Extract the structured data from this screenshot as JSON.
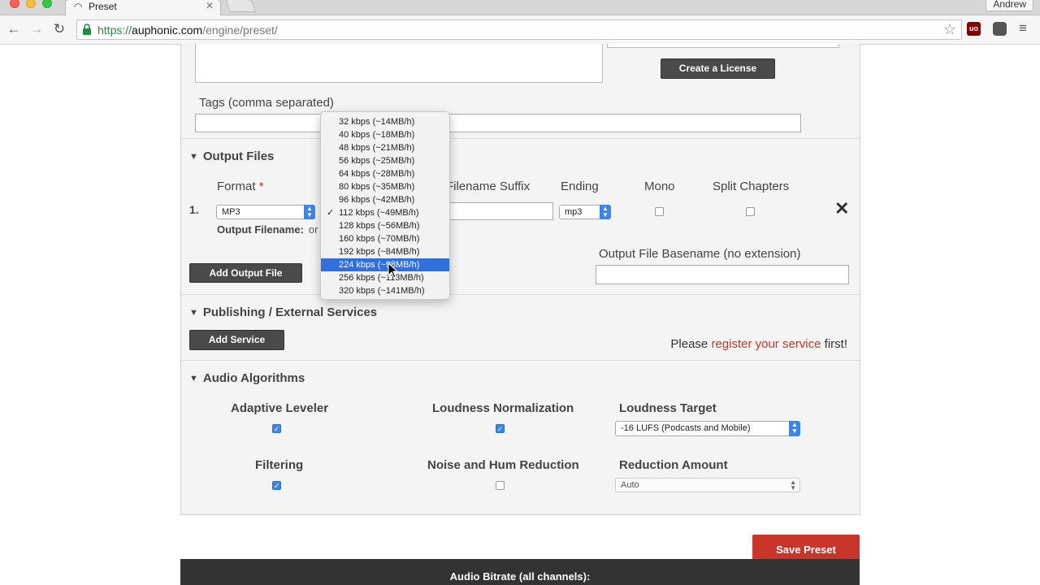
{
  "browser": {
    "tab_title": "Preset",
    "profile_name": "Andrew",
    "url_protocol": "https://",
    "url_host": "auphonic.com",
    "url_path": "/engine/preset/",
    "ub_label": "uo"
  },
  "license": {
    "button_label": "Create a License"
  },
  "tags": {
    "label": "Tags (comma separated)",
    "value": ""
  },
  "output_files": {
    "section_title": "Output Files",
    "columns": {
      "format": "Format",
      "required_mark": "*",
      "filename_suffix": "Filename Suffix",
      "ending": "Ending",
      "mono": "Mono",
      "split_chapters": "Split Chapters"
    },
    "rows": [
      {
        "number": "1.",
        "format": "MP3",
        "filename_suffix": "",
        "ending": "mp3",
        "mono": false,
        "split_chapters": false,
        "output_filename_label": "Output Filename:",
        "output_filename_value": "or"
      }
    ],
    "add_button": "Add Output File",
    "basename_label": "Output File Basename (no extension)",
    "basename_value": ""
  },
  "publishing": {
    "section_title": "Publishing / External Services",
    "add_button": "Add Service",
    "notice_prefix": "Please",
    "notice_link": "register your service",
    "notice_suffix": "first!"
  },
  "audio_algorithms": {
    "section_title": "Audio Algorithms",
    "adaptive_leveler": {
      "label": "Adaptive Leveler",
      "checked": true
    },
    "loudness_normalization": {
      "label": "Loudness Normalization",
      "checked": true
    },
    "loudness_target": {
      "label": "Loudness Target",
      "value": "-16 LUFS (Podcasts and Mobile)"
    },
    "filtering": {
      "label": "Filtering",
      "checked": true
    },
    "noise_hum_reduction": {
      "label": "Noise and Hum Reduction",
      "checked": false
    },
    "reduction_amount": {
      "label": "Reduction Amount",
      "value": "Auto"
    }
  },
  "save_button": "Save Preset",
  "footer": {
    "text": "Audio Bitrate (all channels):"
  },
  "bitrate_dropdown": {
    "options": [
      "32 kbps (~14MB/h)",
      "40 kbps (~18MB/h)",
      "48 kbps (~21MB/h)",
      "56 kbps (~25MB/h)",
      "64 kbps (~28MB/h)",
      "80 kbps (~35MB/h)",
      "96 kbps (~42MB/h)",
      "112 kbps (~49MB/h)",
      "128 kbps (~56MB/h)",
      "160 kbps (~70MB/h)",
      "192 kbps (~84MB/h)",
      "224 kbps (~98MB/h)",
      "256 kbps (~113MB/h)",
      "320 kbps (~141MB/h)"
    ],
    "checked_option": "112 kbps (~49MB/h)",
    "highlighted_option": "224 kbps (~98MB/h)",
    "checkmark": "✓"
  },
  "colors": {
    "accent_blue": "#2f6fde",
    "danger_red": "#c9352b",
    "dark_button": "#4a4a4a"
  }
}
